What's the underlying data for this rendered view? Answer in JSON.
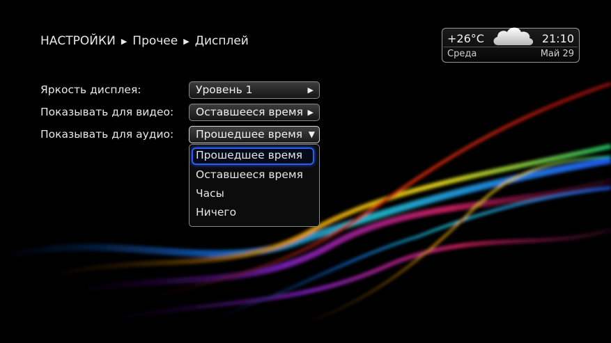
{
  "breadcrumb": {
    "items": [
      "НАСТРОЙКИ",
      "Прочее",
      "Дисплей"
    ],
    "separator": "▶"
  },
  "weather": {
    "temperature": "+26°C",
    "time": "21:10",
    "day": "Среда",
    "date": "Май 29",
    "icon": "cloud-icon"
  },
  "settings": [
    {
      "label": "Яркость дисплея:",
      "value": "Уровень 1",
      "arrow": "▶"
    },
    {
      "label": "Показывать для видео:",
      "value": "Оставшееся время",
      "arrow": "▶"
    },
    {
      "label": "Показывать для аудио:",
      "value": "Прошедшее время",
      "arrow": "▼"
    }
  ],
  "dropdown": {
    "options": [
      "Прошедшее время",
      "Оставшееся время",
      "Часы",
      "Ничего"
    ],
    "selected": "Прошедшее время"
  },
  "colors": {
    "focus": "#2a5cf0",
    "background": "#000000"
  }
}
